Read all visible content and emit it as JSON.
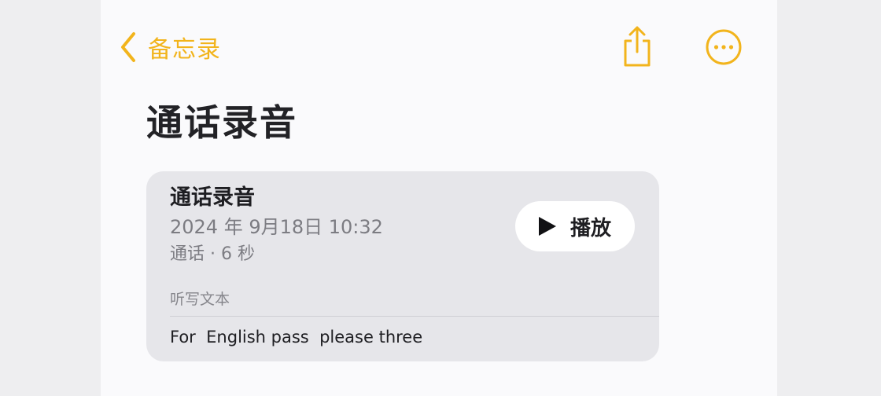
{
  "nav": {
    "back_label": "备忘录",
    "share_icon": "share-icon",
    "more_icon": "more-icon"
  },
  "page": {
    "title": "通话录音"
  },
  "recording": {
    "title": "通话录音",
    "datetime": "2024 年 9月18日 10:32",
    "meta": "通话 · 6 秒",
    "play_label": "播放",
    "transcript_label": "听写文本",
    "transcript": "For  English pass  please three"
  },
  "colors": {
    "accent": "#f2b41c",
    "card_background": "#e6e6ea",
    "page_background": "#fafafc"
  }
}
